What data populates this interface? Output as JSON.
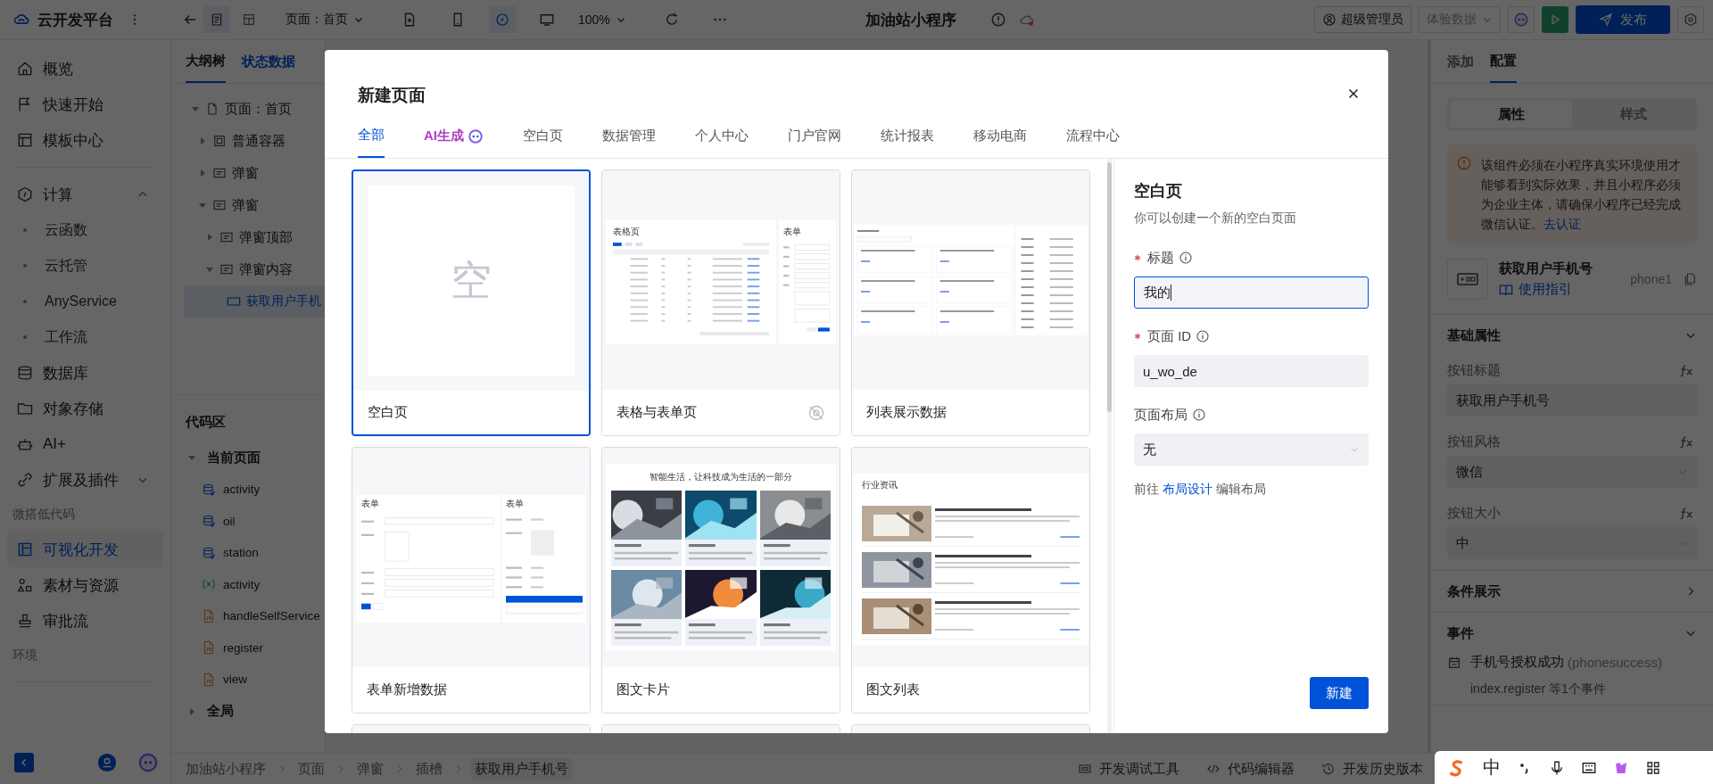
{
  "top_bar": {
    "logo": "云开发平台",
    "page_selector": "页面：首页",
    "zoom": "100%",
    "app_title": "加油站小程序",
    "user": "超级管理员",
    "env": "体验数据",
    "publish": "发布"
  },
  "sidebar": {
    "nav": [
      {
        "kind": "item",
        "label": "概览",
        "selected": false
      },
      {
        "kind": "item",
        "label": "快速开始",
        "selected": false
      },
      {
        "kind": "item",
        "label": "模板中心",
        "selected": false
      },
      {
        "kind": "divider"
      },
      {
        "kind": "group",
        "label": "计算",
        "expanded": true,
        "selected": false,
        "children": [
          {
            "label": "云函数",
            "selected": false
          },
          {
            "label": "云托管",
            "selected": false
          },
          {
            "label": "AnyService",
            "selected": false
          },
          {
            "label": "工作流",
            "selected": false
          }
        ]
      },
      {
        "kind": "item",
        "label": "数据库",
        "selected": false
      },
      {
        "kind": "item",
        "label": "对象存储",
        "selected": false
      },
      {
        "kind": "item",
        "label": "AI+",
        "selected": false
      },
      {
        "kind": "group",
        "label": "扩展及插件",
        "expanded": false,
        "selected": false
      },
      {
        "kind": "section",
        "label": "微搭低代码"
      },
      {
        "kind": "item",
        "label": "可视化开发",
        "selected": true
      },
      {
        "kind": "item",
        "label": "素材与资源",
        "selected": false
      },
      {
        "kind": "item",
        "label": "审批流",
        "selected": false
      },
      {
        "kind": "section",
        "label": "环境"
      },
      {
        "kind": "divider"
      }
    ]
  },
  "outline": {
    "tabs": [
      {
        "label": "大纲树",
        "selected": true
      },
      {
        "label": "状态数据",
        "selected": false
      }
    ],
    "tree": [
      {
        "kind": "page",
        "label": "页面：首页",
        "expanded": true,
        "selected": false,
        "children": [
          {
            "kind": "container",
            "label": "普通容器",
            "expanded": false,
            "selected": false
          },
          {
            "kind": "dialog",
            "label": "弹窗",
            "expanded": false,
            "selected": false
          },
          {
            "kind": "dialog",
            "label": "弹窗",
            "expanded": true,
            "selected": false,
            "children": [
              {
                "kind": "dialog",
                "label": "弹窗顶部",
                "expanded": false,
                "selected": false
              },
              {
                "kind": "dialog",
                "label": "弹窗内容",
                "expanded": true,
                "selected": false,
                "children": [
                  {
                    "kind": "phone",
                    "label": "获取用户手机",
                    "selected": true
                  }
                ]
              }
            ]
          }
        ]
      }
    ]
  },
  "code_area": {
    "title": "代码区",
    "groups": [
      {
        "label": "当前页面",
        "expanded": true,
        "items": [
          {
            "kind": "datasource",
            "label": "activity"
          },
          {
            "kind": "datasource",
            "label": "oil"
          },
          {
            "kind": "datasource",
            "label": "station"
          },
          {
            "kind": "variable",
            "label": "activity"
          },
          {
            "kind": "script",
            "label": "handleSelfService"
          },
          {
            "kind": "script",
            "label": "register"
          },
          {
            "kind": "script",
            "label": "view"
          }
        ]
      },
      {
        "label": "全局",
        "expanded": false
      }
    ]
  },
  "bottom_bar": {
    "breadcrumb": [
      {
        "label": "加油站小程序",
        "selected": false
      },
      {
        "label": "页面",
        "selected": false
      },
      {
        "label": "弹窗",
        "selected": false
      },
      {
        "label": "插槽",
        "selected": false
      },
      {
        "label": "获取用户手机号",
        "selected": true
      }
    ],
    "tools": [
      {
        "kind": "debug",
        "label": "开发调试工具"
      },
      {
        "kind": "code",
        "label": "代码编辑器"
      },
      {
        "kind": "history",
        "label": "开发历史版本"
      }
    ]
  },
  "right_panel": {
    "tabs": [
      {
        "label": "添加",
        "selected": false
      },
      {
        "label": "配置",
        "selected": true
      }
    ],
    "segments": [
      {
        "label": "属性",
        "selected": true
      },
      {
        "label": "样式",
        "selected": false
      }
    ],
    "warning": {
      "text": "该组件必须在小程序真实环境使用才能够看到实际效果，并且小程序必须为企业主体，请确保小程序已经完成微信认证。",
      "link": "去认证"
    },
    "component": {
      "name": "获取用户手机号",
      "id": "phone1",
      "guide": "使用指引"
    },
    "sections": [
      {
        "title": "基础属性",
        "expanded": true,
        "fields": [
          {
            "label": "按钮标题",
            "kind": "input",
            "value": "获取用户手机号"
          },
          {
            "label": "按钮风格",
            "kind": "select",
            "value": "微信"
          },
          {
            "label": "按钮大小",
            "kind": "select",
            "value": "中"
          }
        ]
      },
      {
        "title": "条件展示",
        "expanded": false
      },
      {
        "title": "事件",
        "expanded": true,
        "events": [
          {
            "name": "手机号授权成功",
            "code": "(phonesuccess)",
            "detail": "index.register 等1个事件"
          }
        ]
      }
    ]
  },
  "modal": {
    "title": "新建页面",
    "tabs": [
      {
        "kind": "text",
        "label": "全部",
        "selected": true
      },
      {
        "kind": "ai",
        "label": "AI生成",
        "selected": false
      },
      {
        "kind": "text",
        "label": "空白页",
        "selected": false
      },
      {
        "kind": "text",
        "label": "数据管理",
        "selected": false
      },
      {
        "kind": "text",
        "label": "个人中心",
        "selected": false
      },
      {
        "kind": "text",
        "label": "门户官网",
        "selected": false
      },
      {
        "kind": "text",
        "label": "统计报表",
        "selected": false
      },
      {
        "kind": "text",
        "label": "移动电商",
        "selected": false
      },
      {
        "kind": "text",
        "label": "流程中心",
        "selected": false
      }
    ],
    "templates": [
      {
        "kind": "blank",
        "name": "空白页",
        "selected": true,
        "no_preview": false,
        "texts": [
          "空"
        ]
      },
      {
        "kind": "table_form",
        "name": "表格与表单页",
        "selected": false,
        "no_preview": true,
        "texts": [
          "表格页",
          "表单"
        ]
      },
      {
        "kind": "list",
        "name": "列表展示数据",
        "selected": false,
        "no_preview": false
      },
      {
        "kind": "form",
        "name": "表单新增数据",
        "selected": false,
        "no_preview": false,
        "texts": [
          "表单",
          "表单"
        ]
      },
      {
        "kind": "cards",
        "name": "图文卡片",
        "selected": false,
        "no_preview": false,
        "texts": [
          "智能生活，让科技成为生活的一部分"
        ]
      },
      {
        "kind": "news",
        "name": "图文列表",
        "selected": false,
        "no_preview": false,
        "texts": [
          "行业资讯"
        ]
      },
      {
        "kind": "cut",
        "selected": false
      },
      {
        "kind": "cut",
        "selected": false
      },
      {
        "kind": "cut",
        "selected": false
      }
    ],
    "form": {
      "heading": "空白页",
      "description": "你可以创建一个新的空白页面",
      "fields": [
        {
          "kind": "input",
          "label": "标题",
          "required": true,
          "focused": true,
          "value": "我的"
        },
        {
          "kind": "input",
          "label": "页面 ID",
          "required": true,
          "focused": false,
          "value": "u_wo_de"
        },
        {
          "kind": "select",
          "label": "页面布局",
          "required": false,
          "focused": false,
          "value": "无"
        }
      ],
      "hint": {
        "prefix": "前往",
        "link": "布局设计",
        "suffix": "编辑布局"
      },
      "submit": "新建"
    }
  },
  "ime_bar": {
    "mode": "中"
  }
}
